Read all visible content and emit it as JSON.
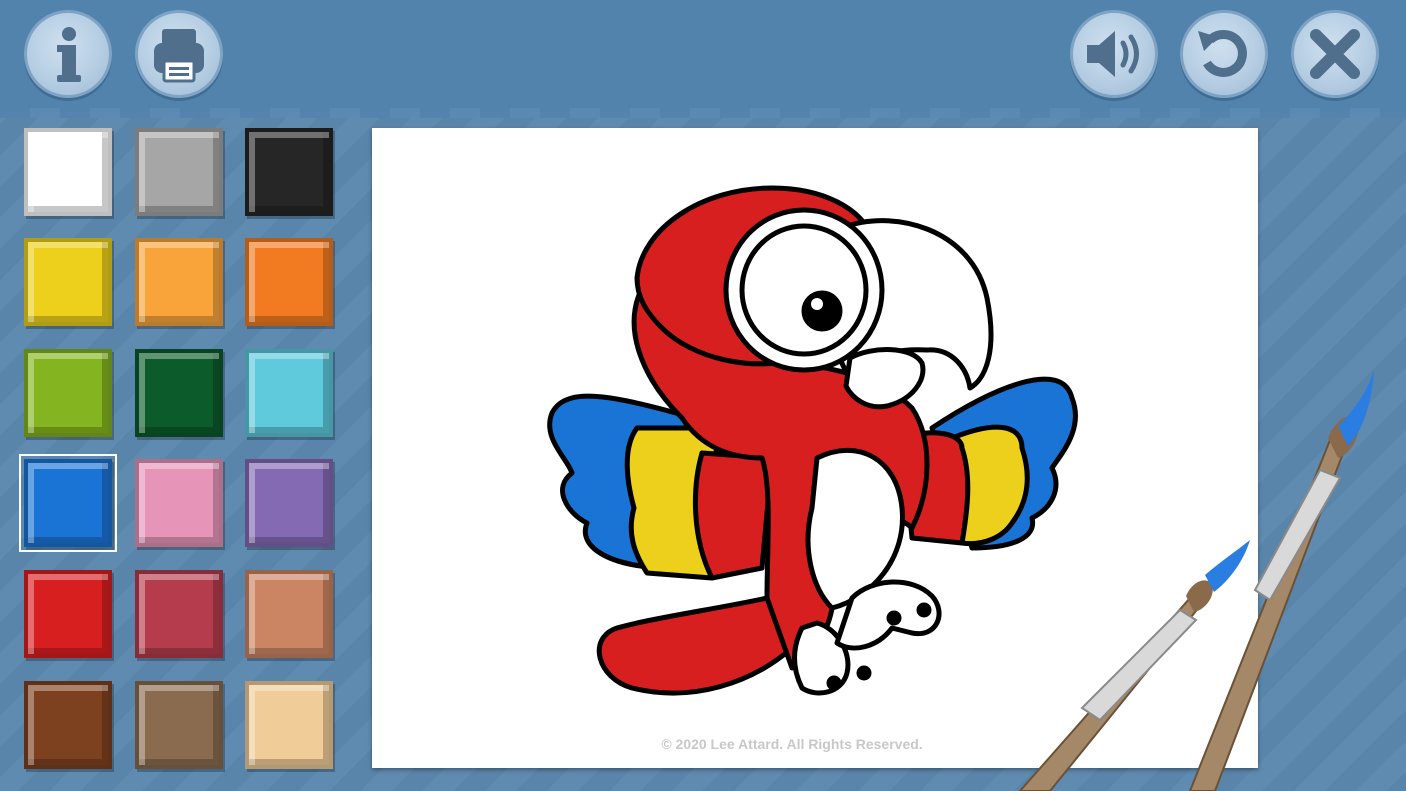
{
  "toolbar": {
    "info": {
      "icon": "info-icon",
      "label": "i"
    },
    "print": {
      "icon": "printer-icon"
    },
    "sound": {
      "icon": "speaker-icon"
    },
    "reset": {
      "icon": "refresh-icon"
    },
    "close": {
      "icon": "close-icon"
    }
  },
  "palette": {
    "selected_index": 9,
    "colors": [
      "#ffffff",
      "#a6a6a6",
      "#262626",
      "#ecd01c",
      "#f8a43b",
      "#f27b22",
      "#84b41f",
      "#0b5b2b",
      "#5ecadc",
      "#1a74d6",
      "#e695b8",
      "#8469b3",
      "#d81f1f",
      "#b53c4c",
      "#cc8562",
      "#7e4120",
      "#8a6b4f",
      "#f0cc99"
    ]
  },
  "canvas": {
    "subject": "parrot coloring page",
    "fill_colors": {
      "head_body": "#d81f1f",
      "wing_tips": "#1a74d6",
      "wing_bands": "#ecd01c"
    },
    "copyright": "© 2020 Lee Attard. All Rights Reserved."
  }
}
